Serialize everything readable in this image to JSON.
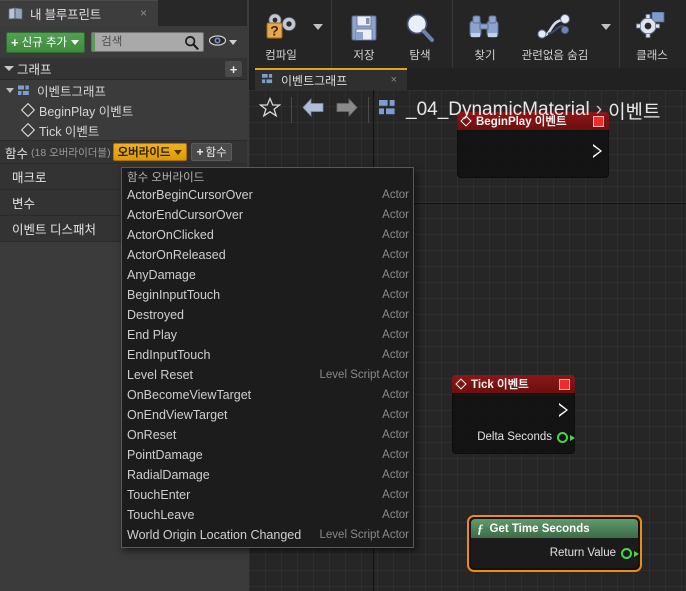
{
  "left_panel": {
    "tab": {
      "label": "내 블루프린트",
      "close": "×",
      "icon": "book-icon"
    },
    "add_new_button": "신규 추가",
    "search": {
      "value": "",
      "placeholder": "검색"
    },
    "graph_section": {
      "title": "그래프",
      "add": "+"
    },
    "tree": [
      {
        "label": "이벤트그래프",
        "type": "graph"
      },
      {
        "label": "BeginPlay 이벤트",
        "type": "event"
      },
      {
        "label": "Tick 이벤트",
        "type": "event"
      }
    ],
    "functions_bar": {
      "title": "함수",
      "count": "(18 오버라이더블)",
      "override_button": "오버라이드",
      "add_function_button": "함수"
    },
    "sections": [
      {
        "label": "매크로"
      },
      {
        "label": "변수"
      },
      {
        "label": "이벤트 디스패처"
      }
    ]
  },
  "override_menu": {
    "header": "함수 오버라이드",
    "items": [
      {
        "name": "ActorBeginCursorOver",
        "category": "Actor"
      },
      {
        "name": "ActorEndCursorOver",
        "category": "Actor"
      },
      {
        "name": "ActorOnClicked",
        "category": "Actor"
      },
      {
        "name": "ActorOnReleased",
        "category": "Actor"
      },
      {
        "name": "AnyDamage",
        "category": "Actor"
      },
      {
        "name": "BeginInputTouch",
        "category": "Actor"
      },
      {
        "name": "Destroyed",
        "category": "Actor"
      },
      {
        "name": "End Play",
        "category": "Actor"
      },
      {
        "name": "EndInputTouch",
        "category": "Actor"
      },
      {
        "name": "Level Reset",
        "category": "Level Script Actor"
      },
      {
        "name": "OnBecomeViewTarget",
        "category": "Actor"
      },
      {
        "name": "OnEndViewTarget",
        "category": "Actor"
      },
      {
        "name": "OnReset",
        "category": "Actor"
      },
      {
        "name": "PointDamage",
        "category": "Actor"
      },
      {
        "name": "RadialDamage",
        "category": "Actor"
      },
      {
        "name": "TouchEnter",
        "category": "Actor"
      },
      {
        "name": "TouchLeave",
        "category": "Actor"
      },
      {
        "name": "World Origin Location Changed",
        "category": "Level Script Actor"
      }
    ]
  },
  "toolbar": {
    "items": [
      {
        "label": "컴파일",
        "icon": "compile-icon",
        "has_caret": true
      },
      {
        "label": "저장",
        "icon": "save-icon",
        "has_caret": false
      },
      {
        "label": "탐색",
        "icon": "browse-icon",
        "has_caret": false
      },
      {
        "label": "찾기",
        "icon": "find-binoculars-icon",
        "has_caret": false
      },
      {
        "label": "관련없음 숨김",
        "icon": "hide-unrelated-icon",
        "has_caret": true
      },
      {
        "label": "클래스",
        "icon": "class-settings-icon",
        "has_caret": false
      }
    ]
  },
  "graph": {
    "tab": {
      "label": "이벤트그래프",
      "close": "×",
      "icon": "graph-icon"
    },
    "breadcrumb": {
      "blueprint_name": "_04_DynamicMaterial",
      "separator": "›",
      "current": "이벤트"
    },
    "nodes": [
      {
        "id": "beginplay",
        "title": "BeginPlay 이벤트",
        "type": "event",
        "pins": [
          {
            "label": "",
            "kind": "exec"
          }
        ]
      },
      {
        "id": "tick",
        "title": "Tick 이벤트",
        "type": "event",
        "pins": [
          {
            "label": "",
            "kind": "exec"
          },
          {
            "label": "Delta Seconds",
            "kind": "data"
          }
        ]
      },
      {
        "id": "get_time_seconds",
        "title": "Get Time Seconds",
        "type": "function",
        "selected": true,
        "pins": [
          {
            "label": "Return Value",
            "kind": "data"
          }
        ]
      }
    ]
  },
  "colors": {
    "accent_orange": "#e3a616",
    "selection_orange": "#ef8b11",
    "event_red": "#8e1616",
    "function_green": "#5f9b6b",
    "data_pin_green": "#4cd44c",
    "add_new_green": "#52a052"
  }
}
